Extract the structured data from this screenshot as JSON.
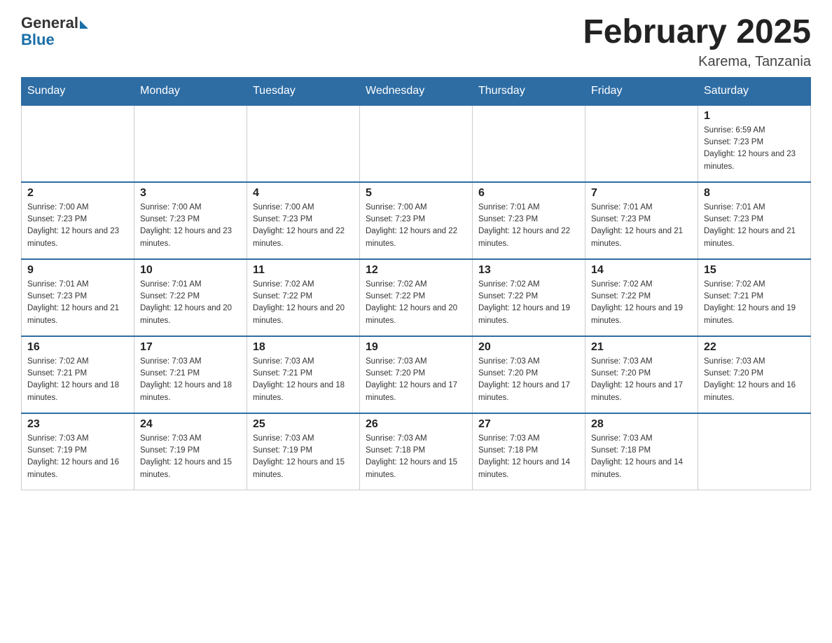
{
  "header": {
    "logo_general": "General",
    "logo_blue": "Blue",
    "month_title": "February 2025",
    "location": "Karema, Tanzania"
  },
  "weekdays": [
    "Sunday",
    "Monday",
    "Tuesday",
    "Wednesday",
    "Thursday",
    "Friday",
    "Saturday"
  ],
  "weeks": [
    [
      {
        "day": "",
        "info": ""
      },
      {
        "day": "",
        "info": ""
      },
      {
        "day": "",
        "info": ""
      },
      {
        "day": "",
        "info": ""
      },
      {
        "day": "",
        "info": ""
      },
      {
        "day": "",
        "info": ""
      },
      {
        "day": "1",
        "info": "Sunrise: 6:59 AM\nSunset: 7:23 PM\nDaylight: 12 hours and 23 minutes."
      }
    ],
    [
      {
        "day": "2",
        "info": "Sunrise: 7:00 AM\nSunset: 7:23 PM\nDaylight: 12 hours and 23 minutes."
      },
      {
        "day": "3",
        "info": "Sunrise: 7:00 AM\nSunset: 7:23 PM\nDaylight: 12 hours and 23 minutes."
      },
      {
        "day": "4",
        "info": "Sunrise: 7:00 AM\nSunset: 7:23 PM\nDaylight: 12 hours and 22 minutes."
      },
      {
        "day": "5",
        "info": "Sunrise: 7:00 AM\nSunset: 7:23 PM\nDaylight: 12 hours and 22 minutes."
      },
      {
        "day": "6",
        "info": "Sunrise: 7:01 AM\nSunset: 7:23 PM\nDaylight: 12 hours and 22 minutes."
      },
      {
        "day": "7",
        "info": "Sunrise: 7:01 AM\nSunset: 7:23 PM\nDaylight: 12 hours and 21 minutes."
      },
      {
        "day": "8",
        "info": "Sunrise: 7:01 AM\nSunset: 7:23 PM\nDaylight: 12 hours and 21 minutes."
      }
    ],
    [
      {
        "day": "9",
        "info": "Sunrise: 7:01 AM\nSunset: 7:23 PM\nDaylight: 12 hours and 21 minutes."
      },
      {
        "day": "10",
        "info": "Sunrise: 7:01 AM\nSunset: 7:22 PM\nDaylight: 12 hours and 20 minutes."
      },
      {
        "day": "11",
        "info": "Sunrise: 7:02 AM\nSunset: 7:22 PM\nDaylight: 12 hours and 20 minutes."
      },
      {
        "day": "12",
        "info": "Sunrise: 7:02 AM\nSunset: 7:22 PM\nDaylight: 12 hours and 20 minutes."
      },
      {
        "day": "13",
        "info": "Sunrise: 7:02 AM\nSunset: 7:22 PM\nDaylight: 12 hours and 19 minutes."
      },
      {
        "day": "14",
        "info": "Sunrise: 7:02 AM\nSunset: 7:22 PM\nDaylight: 12 hours and 19 minutes."
      },
      {
        "day": "15",
        "info": "Sunrise: 7:02 AM\nSunset: 7:21 PM\nDaylight: 12 hours and 19 minutes."
      }
    ],
    [
      {
        "day": "16",
        "info": "Sunrise: 7:02 AM\nSunset: 7:21 PM\nDaylight: 12 hours and 18 minutes."
      },
      {
        "day": "17",
        "info": "Sunrise: 7:03 AM\nSunset: 7:21 PM\nDaylight: 12 hours and 18 minutes."
      },
      {
        "day": "18",
        "info": "Sunrise: 7:03 AM\nSunset: 7:21 PM\nDaylight: 12 hours and 18 minutes."
      },
      {
        "day": "19",
        "info": "Sunrise: 7:03 AM\nSunset: 7:20 PM\nDaylight: 12 hours and 17 minutes."
      },
      {
        "day": "20",
        "info": "Sunrise: 7:03 AM\nSunset: 7:20 PM\nDaylight: 12 hours and 17 minutes."
      },
      {
        "day": "21",
        "info": "Sunrise: 7:03 AM\nSunset: 7:20 PM\nDaylight: 12 hours and 17 minutes."
      },
      {
        "day": "22",
        "info": "Sunrise: 7:03 AM\nSunset: 7:20 PM\nDaylight: 12 hours and 16 minutes."
      }
    ],
    [
      {
        "day": "23",
        "info": "Sunrise: 7:03 AM\nSunset: 7:19 PM\nDaylight: 12 hours and 16 minutes."
      },
      {
        "day": "24",
        "info": "Sunrise: 7:03 AM\nSunset: 7:19 PM\nDaylight: 12 hours and 15 minutes."
      },
      {
        "day": "25",
        "info": "Sunrise: 7:03 AM\nSunset: 7:19 PM\nDaylight: 12 hours and 15 minutes."
      },
      {
        "day": "26",
        "info": "Sunrise: 7:03 AM\nSunset: 7:18 PM\nDaylight: 12 hours and 15 minutes."
      },
      {
        "day": "27",
        "info": "Sunrise: 7:03 AM\nSunset: 7:18 PM\nDaylight: 12 hours and 14 minutes."
      },
      {
        "day": "28",
        "info": "Sunrise: 7:03 AM\nSunset: 7:18 PM\nDaylight: 12 hours and 14 minutes."
      },
      {
        "day": "",
        "info": ""
      }
    ]
  ]
}
